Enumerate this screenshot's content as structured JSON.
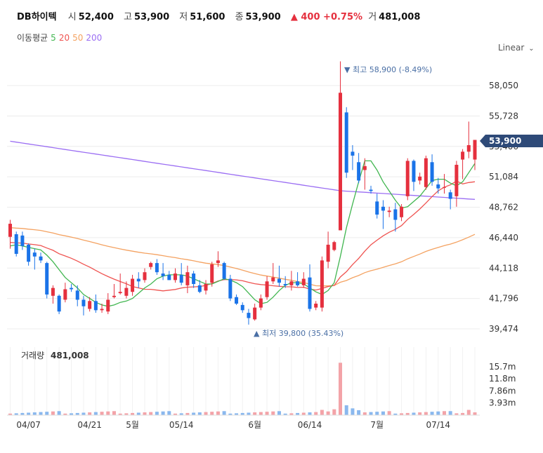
{
  "header": {
    "name": "DB하이텍",
    "open_label": "시",
    "open": "52,400",
    "high_label": "고",
    "high": "53,900",
    "low_label": "저",
    "low": "51,600",
    "close_label": "종",
    "close": "53,900",
    "change": "▲ 400 +0.75%",
    "volume_label": "거",
    "volume": "481,008"
  },
  "ma_legend": {
    "label": "이동평균",
    "items": [
      {
        "text": "5",
        "color": "#41b650"
      },
      {
        "text": "20",
        "color": "#ef5350"
      },
      {
        "text": "50",
        "color": "#f4a261"
      },
      {
        "text": "200",
        "color": "#9b6ef3"
      }
    ]
  },
  "scale": {
    "label": "Linear",
    "icon": "chevron-down-icon"
  },
  "colors": {
    "up": "#e5303e",
    "down": "#1a73e8",
    "vol_up": "#f3a3a8",
    "vol_down": "#8ab8ee",
    "grid": "#ececec"
  },
  "chart_data": {
    "type": "candlestick",
    "y_ticks": [
      "58,050",
      "55,728",
      "53,406",
      "51,084",
      "48,762",
      "46,440",
      "44,118",
      "41,796",
      "39,474"
    ],
    "y_tick_values": [
      58050,
      55728,
      53406,
      51084,
      48762,
      46440,
      44118,
      41796,
      39474
    ],
    "x_labels": [
      "04/07",
      "04/21",
      "5월",
      "05/14",
      "6월",
      "06/14",
      "7월",
      "07/14"
    ],
    "x_label_index": [
      3,
      13,
      20,
      28,
      40,
      49,
      60,
      70
    ],
    "current_price": "53,900",
    "annotation_high": "▼ 최고 58,900 (-8.49%)",
    "annotation_low": "▲ 최저 39,800 (35.43%)",
    "volume_title": "거래량",
    "volume_value": "481,008",
    "volume_ticks": [
      "15.7m",
      "11.8m",
      "7.86m",
      "3.93m"
    ],
    "volume_tick_values": [
      15.7,
      11.8,
      7.86,
      3.93
    ],
    "candles": [
      [
        46500,
        47800,
        45600,
        47500
      ],
      [
        46700,
        46900,
        45000,
        45200
      ],
      [
        46600,
        46900,
        45500,
        45800
      ],
      [
        45900,
        46000,
        44300,
        44600
      ],
      [
        45300,
        45600,
        44000,
        45000
      ],
      [
        45000,
        45300,
        44500,
        44700
      ],
      [
        44500,
        44600,
        41800,
        42100
      ],
      [
        42000,
        42800,
        41400,
        42600
      ],
      [
        42000,
        42100,
        40600,
        40800
      ],
      [
        41700,
        43000,
        41500,
        42500
      ],
      [
        42600,
        42900,
        42300,
        42500
      ],
      [
        42400,
        42800,
        41200,
        41700
      ],
      [
        41700,
        42000,
        40500,
        41200
      ],
      [
        41000,
        41900,
        40800,
        41600
      ],
      [
        41600,
        42100,
        40700,
        40900
      ],
      [
        40900,
        41400,
        40700,
        41000
      ],
      [
        40800,
        42200,
        40600,
        41700
      ],
      [
        41900,
        42900,
        41800,
        42000
      ],
      [
        42200,
        43700,
        42100,
        42300
      ],
      [
        42000,
        43100,
        41800,
        42600
      ],
      [
        42300,
        43600,
        42000,
        43300
      ],
      [
        43300,
        43800,
        42600,
        43100
      ],
      [
        43200,
        44100,
        43000,
        43800
      ],
      [
        44200,
        44600,
        44000,
        44500
      ],
      [
        44500,
        44800,
        43600,
        43800
      ],
      [
        43700,
        44500,
        43200,
        43500
      ],
      [
        43600,
        43900,
        43200,
        43200
      ],
      [
        43200,
        44100,
        43000,
        43700
      ],
      [
        43600,
        44500,
        42800,
        43000
      ],
      [
        42800,
        44300,
        42200,
        43800
      ],
      [
        43700,
        43900,
        42600,
        42900
      ],
      [
        42800,
        43200,
        42200,
        42300
      ],
      [
        42400,
        43200,
        42100,
        42900
      ],
      [
        43000,
        44600,
        42700,
        44400
      ],
      [
        44500,
        45400,
        44200,
        44700
      ],
      [
        44500,
        44600,
        43200,
        43300
      ],
      [
        43300,
        43600,
        41600,
        41800
      ],
      [
        41900,
        42100,
        41300,
        41400
      ],
      [
        41300,
        41500,
        40700,
        40900
      ],
      [
        40700,
        41000,
        39800,
        40300
      ],
      [
        40200,
        41400,
        40100,
        41100
      ],
      [
        41100,
        42100,
        40900,
        41800
      ],
      [
        41900,
        43500,
        41700,
        43100
      ],
      [
        43100,
        44500,
        42900,
        43400
      ],
      [
        43300,
        44300,
        42700,
        43000
      ],
      [
        42900,
        43500,
        42600,
        42800
      ],
      [
        42800,
        43900,
        42400,
        43100
      ],
      [
        43100,
        43800,
        42700,
        42800
      ],
      [
        42800,
        43800,
        42600,
        43300
      ],
      [
        43400,
        44400,
        40800,
        41000
      ],
      [
        41100,
        41600,
        40900,
        41400
      ],
      [
        41100,
        45000,
        40800,
        44700
      ],
      [
        44600,
        46900,
        44100,
        45900
      ],
      [
        45500,
        46200,
        45400,
        46100
      ],
      [
        47000,
        59900,
        47200,
        57500
      ],
      [
        56000,
        56400,
        51000,
        51400
      ],
      [
        53000,
        53500,
        51600,
        52700
      ],
      [
        52200,
        52900,
        50600,
        50800
      ],
      [
        51600,
        52500,
        50100,
        51900
      ],
      [
        50100,
        50400,
        49800,
        50000
      ],
      [
        49200,
        49800,
        47900,
        48200
      ],
      [
        48800,
        49300,
        47100,
        48500
      ],
      [
        48400,
        48800,
        48000,
        48500
      ],
      [
        48600,
        49100,
        46900,
        47800
      ],
      [
        48000,
        49000,
        47700,
        48800
      ],
      [
        49600,
        52500,
        49300,
        52300
      ],
      [
        52300,
        52400,
        50000,
        50700
      ],
      [
        50800,
        51400,
        50500,
        51100
      ],
      [
        50300,
        52700,
        50100,
        52500
      ],
      [
        52200,
        52800,
        50400,
        50700
      ],
      [
        50500,
        51000,
        49800,
        50200
      ],
      [
        50300,
        51300,
        49800,
        50300
      ],
      [
        49900,
        50100,
        48600,
        49400
      ],
      [
        49600,
        52300,
        48800,
        52000
      ],
      [
        52400,
        53200,
        50900,
        53000
      ],
      [
        53000,
        55300,
        52500,
        53500
      ],
      [
        52400,
        53900,
        51600,
        53900
      ]
    ],
    "ma5": [
      45800,
      45900,
      45800,
      45700,
      45600,
      45500,
      45100,
      44600,
      44000,
      43400,
      43000,
      42600,
      42100,
      41800,
      41500,
      41300,
      41200,
      41300,
      41500,
      41600,
      41800,
      42200,
      42600,
      42900,
      43300,
      43500,
      43600,
      43600,
      43600,
      43500,
      43300,
      43100,
      42900,
      42900,
      43100,
      43300,
      43200,
      43000,
      42700,
      42200,
      41700,
      41400,
      41500,
      41900,
      42400,
      42800,
      43000,
      43000,
      42900,
      42600,
      42300,
      42100,
      42400,
      43000,
      45000,
      47200,
      49000,
      50700,
      52300,
      52300,
      51600,
      50700,
      50000,
      49300,
      48700,
      48800,
      49200,
      49600,
      50200,
      50800,
      50900,
      50900,
      50600,
      50400,
      50700,
      51400,
      52100
    ]
  }
}
